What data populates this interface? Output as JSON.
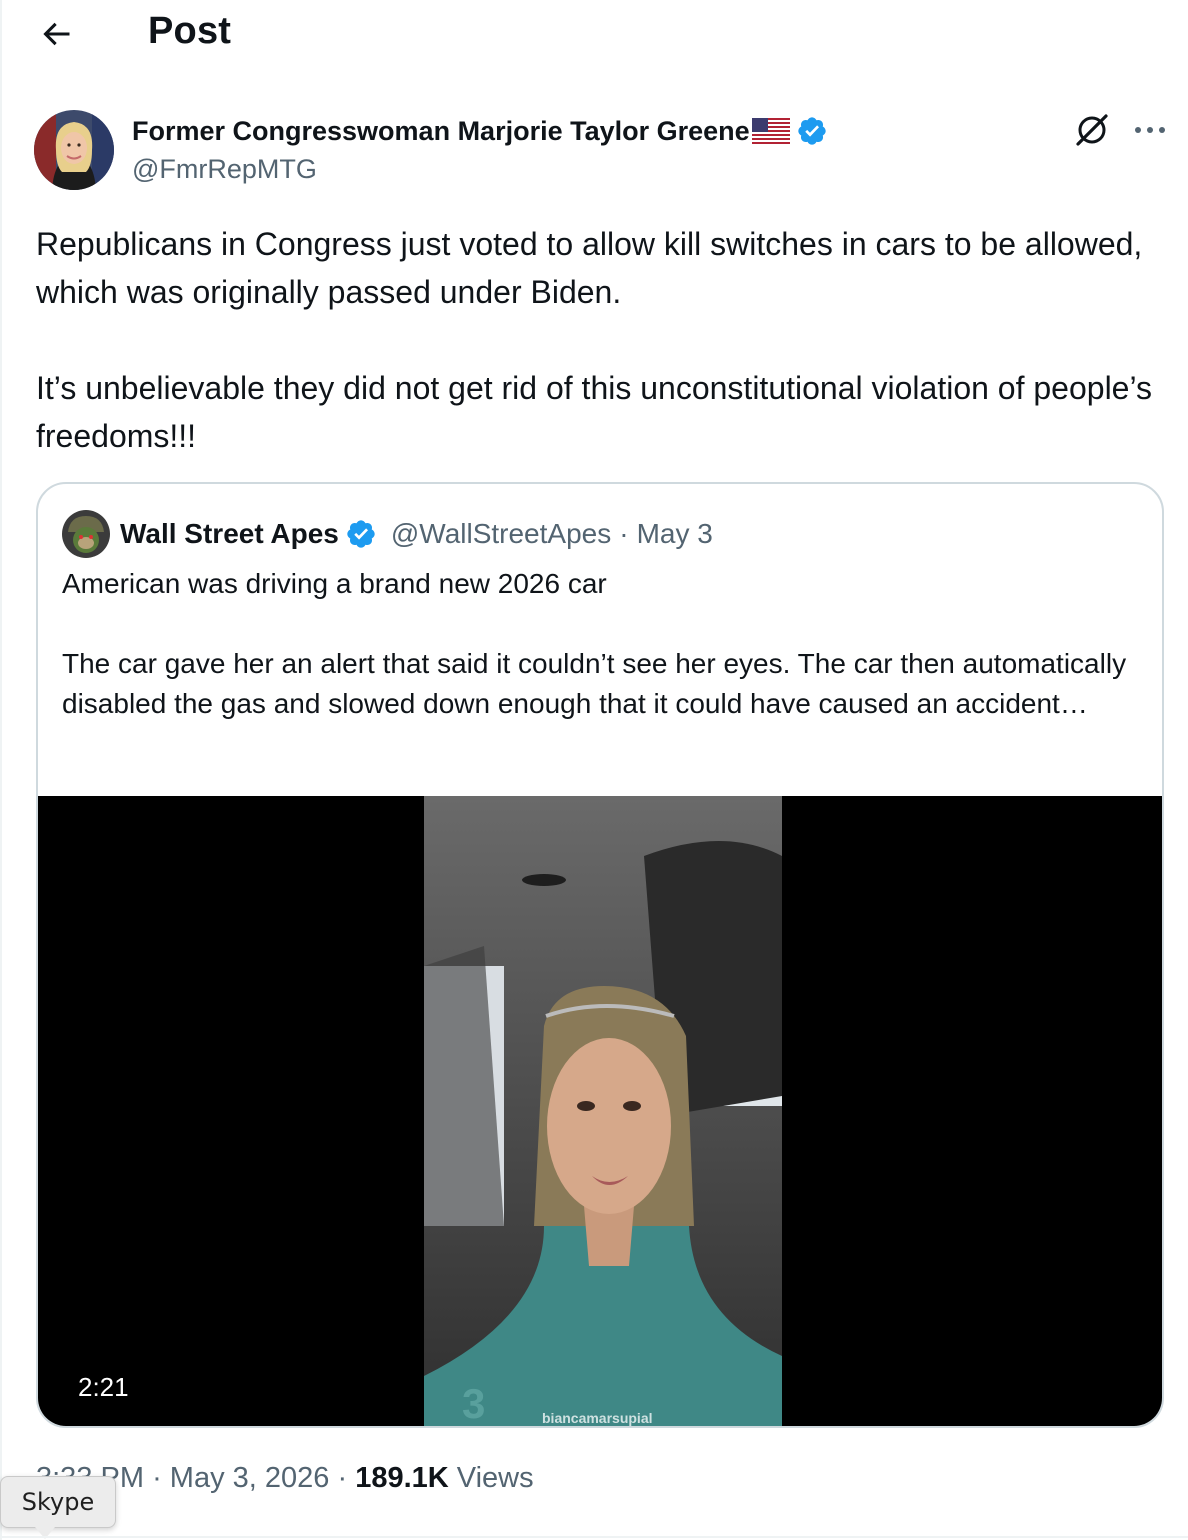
{
  "header": {
    "title": "Post",
    "back_icon": "arrow-left-icon"
  },
  "post": {
    "author_name": "Former Congresswoman Marjorie Taylor Greene",
    "author_flag": "us-flag-icon",
    "author_handle": "@FmrRepMTG",
    "text": "Republicans in Congress just voted to allow kill switches in cars to be allowed, which was originally passed under Biden.\n\nIt’s unbelievable they did not get rid of this unconstitutional violation of people’s freedoms!!!",
    "meta": {
      "time": "3:33 PM",
      "separator": "·",
      "date": "May 3, 2026",
      "views_count": "189.1K",
      "views_label": "Views"
    }
  },
  "quote": {
    "author_name": "Wall Street Apes",
    "author_handle": "@WallStreetApes",
    "separator": "·",
    "date": "May 3",
    "text": "American was driving a brand new 2026 car\n\nThe car gave her an alert that said it couldn’t see her eyes. The car then automatically disabled the gas and slowed down enough that it could have caused an accident…",
    "video": {
      "duration": "2:21",
      "watermark": "biancamarsupial"
    }
  },
  "tooltip": {
    "label": "Skype"
  },
  "colors": {
    "text_primary": "#0f1419",
    "text_secondary": "#536471",
    "verified_blue": "#1d9bf0",
    "border": "#cfd9de"
  }
}
